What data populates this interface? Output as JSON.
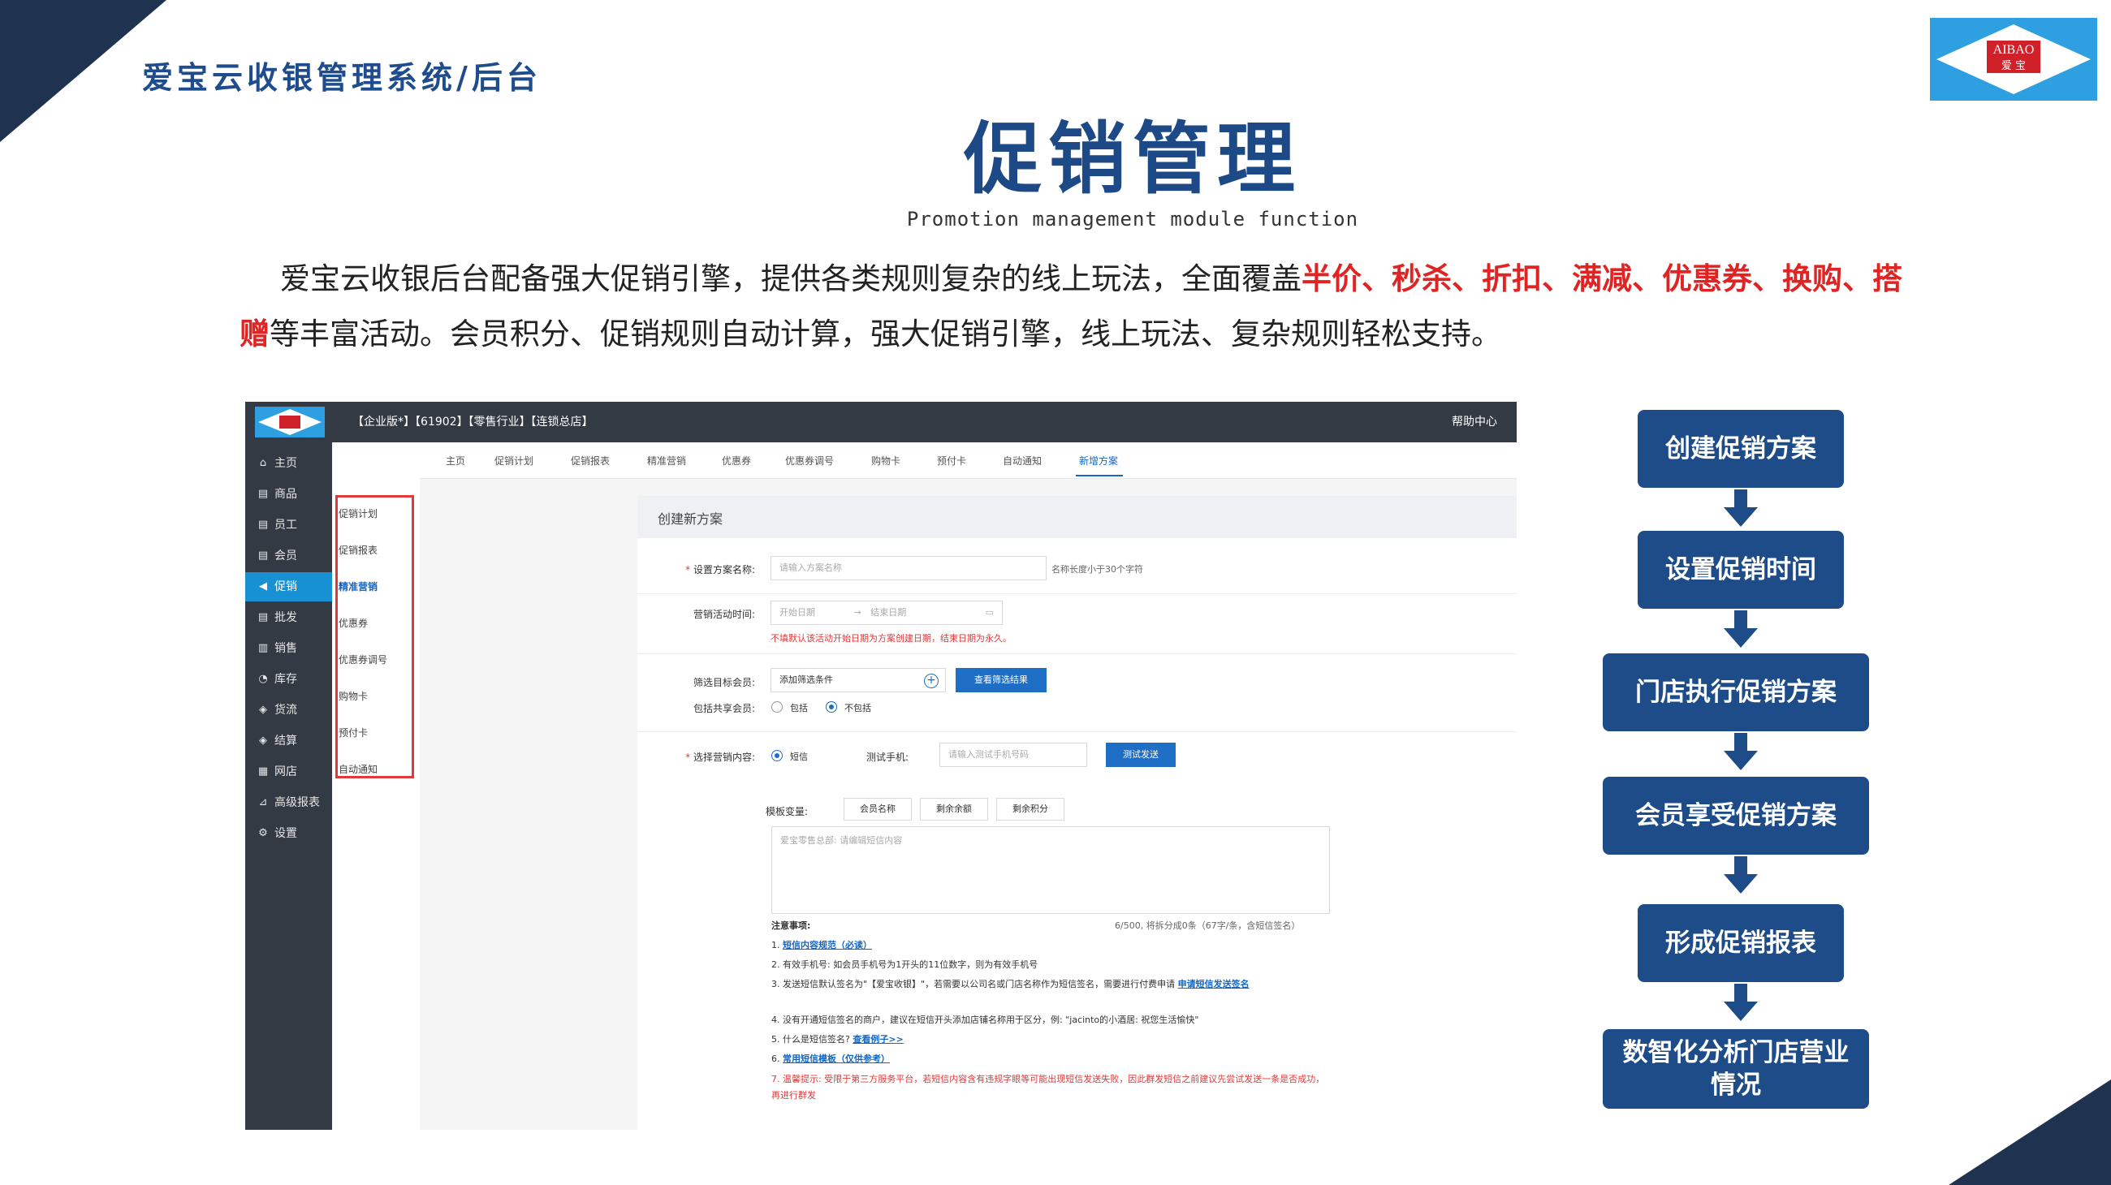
{
  "header": {
    "brand_title": "爱宝云收银管理系统/后台",
    "logo_text_top": "AIBAO",
    "logo_text_bottom": "爱 宝",
    "page_title": "促销管理",
    "page_subtitle": "Promotion management module function"
  },
  "intro": {
    "part1": "爱宝云收银后台配备强大促销引擎，提供各类规则复杂的线上玩法，全面覆盖",
    "highlight": "半价、秒杀、折扣、满减、优惠券、换购、搭赠",
    "part2": "等丰富活动。会员积分、促销规则自动计算，强大促销引擎，线上玩法、复杂规则轻松支持。"
  },
  "screenshot": {
    "topbar": {
      "org_info": "【企业版*】【61902】【零售行业】【连锁总店】",
      "help": "帮助中心"
    },
    "sidebar": [
      {
        "label": "主页",
        "icon": "home-icon",
        "glyph": "⌂"
      },
      {
        "label": "商品",
        "icon": "goods-icon",
        "glyph": "▤"
      },
      {
        "label": "员工",
        "icon": "staff-icon",
        "glyph": "▤"
      },
      {
        "label": "会员",
        "icon": "member-icon",
        "glyph": "▤"
      },
      {
        "label": "促销",
        "icon": "promo-icon",
        "glyph": "◀"
      },
      {
        "label": "批发",
        "icon": "wholesale-icon",
        "glyph": "▤"
      },
      {
        "label": "销售",
        "icon": "sales-icon",
        "glyph": "▥"
      },
      {
        "label": "库存",
        "icon": "stock-icon",
        "glyph": "◔"
      },
      {
        "label": "货流",
        "icon": "flow-icon",
        "glyph": "◈"
      },
      {
        "label": "结算",
        "icon": "settle-icon",
        "glyph": "◈"
      },
      {
        "label": "网店",
        "icon": "shop-icon",
        "glyph": "▦"
      },
      {
        "label": "高级报表",
        "icon": "report-icon",
        "glyph": "⊿"
      },
      {
        "label": "设置",
        "icon": "settings-icon",
        "glyph": "⚙"
      }
    ],
    "subnav": [
      "促销计划",
      "促销报表",
      "精准营销",
      "优惠券",
      "优惠券调号",
      "购物卡",
      "预付卡",
      "自动通知"
    ],
    "tabs": [
      "主页",
      "促销计划",
      "促销报表",
      "精准营销",
      "优惠券",
      "优惠券调号",
      "购物卡",
      "预付卡",
      "自动通知",
      "新增方案"
    ],
    "form": {
      "section_title": "创建新方案",
      "name_label": "设置方案名称:",
      "name_placeholder": "请输入方案名称",
      "name_hint": "名称长度小于30个字符",
      "time_label": "营销活动时间:",
      "start_placeholder": "开始日期",
      "end_placeholder": "结束日期",
      "time_arrow": "→",
      "time_warning": "不填默认该活动开始日期为方案创建日期，结束日期为永久。",
      "filter_label": "筛选目标会员:",
      "filter_value": "添加筛选条件",
      "filter_button": "查看筛选结果",
      "share_label": "包括共享会员:",
      "share_opt1": "包括",
      "share_opt2": "不包括",
      "content_label": "选择营销内容:",
      "content_opt": "短信",
      "test_phone_label": "测试手机:",
      "test_phone_placeholder": "请输入测试手机号码",
      "test_send_button": "测试发送",
      "var_label": "模板变量:",
      "vars": [
        "会员名称",
        "剩余余额",
        "剩余积分"
      ],
      "sms_placeholder": "爱宝零售总部: 请编辑短信内容",
      "sms_count": "6/500, 将拆分成0条（67字/条，含短信签名）",
      "notes_title": "注意事项:",
      "note1": "1.",
      "note1_link": "短信内容规范（必读）",
      "note2": "2. 有效手机号: 如会员手机号为1开头的11位数字，则为有效手机号",
      "note3": "3. 发送短信默认签名为\"【爱宝收银】\"，若需要以公司名或门店名称作为短信签名，需要进行付费申请",
      "note3_link": "申请短信发送签名",
      "note4": "4. 没有开通短信签名的商户，建议在短信开头添加店铺名称用于区分，例: \"jacinto的小酒居: 祝您生活愉快\"",
      "note5": "5. 什么是短信签名?",
      "note5_link": "查看例子>>",
      "note6": "6.",
      "note6_link": "常用短信模板（仅供参考）",
      "note7": "7. 温馨提示: 受限于第三方服务平台，若短信内容含有违规字眼等可能出现短信发送失败，因此群发短信之前建议先尝试发送一条是否成功，再进行群发"
    }
  },
  "flow": {
    "steps": [
      "创建促销方案",
      "设置促销时间",
      "门店执行促销方案",
      "会员享受促销方案",
      "形成促销报表",
      "数智化分析门店营业情况"
    ]
  },
  "colors": {
    "navy": "#1f3350",
    "brand_blue": "#1d4a86",
    "flow_blue": "#1e4c88",
    "highlight_red": "#e02424",
    "logo_cyan": "#2ea0e2",
    "nav_active": "#1891d4"
  }
}
